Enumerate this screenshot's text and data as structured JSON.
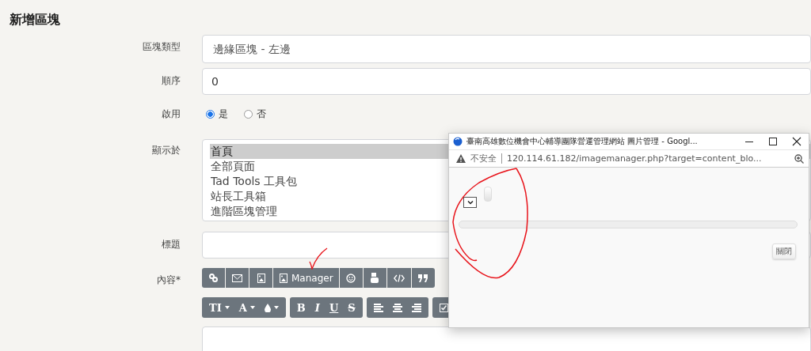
{
  "heading": "新增區塊",
  "form": {
    "block_type": {
      "label": "區塊類型",
      "value": "邊緣區塊 - 左邊"
    },
    "order": {
      "label": "順序",
      "value": "0"
    },
    "enabled": {
      "label": "啟用",
      "options": [
        {
          "label": "是",
          "selected": true
        },
        {
          "label": "否",
          "selected": false
        }
      ]
    },
    "show_on": {
      "label": "顯示於",
      "items": [
        {
          "label": "首頁",
          "selected": true
        },
        {
          "label": "全部頁面",
          "selected": false
        },
        {
          "label": "Tad Tools 工具包",
          "selected": false
        },
        {
          "label": "站長工具箱",
          "selected": false
        },
        {
          "label": "進階區塊管理",
          "selected": false
        }
      ]
    },
    "title": {
      "label": "標題"
    },
    "content": {
      "label": "內容*",
      "toolbar_1": [
        {
          "kind": "link"
        },
        {
          "kind": "mail"
        },
        {
          "kind": "image"
        },
        {
          "kind": "image",
          "text": "Manager"
        },
        {
          "kind": "smiley"
        },
        {
          "kind": "video"
        },
        {
          "kind": "code"
        },
        {
          "kind": "quote"
        }
      ],
      "toolbar_2": [
        [
          {
            "kind": "bold",
            "text": "TI",
            "menu": true
          },
          {
            "kind": "bold",
            "text": "A",
            "menu": true
          },
          {
            "kind": "drop",
            "menu": true
          }
        ],
        [
          {
            "kind": "bold",
            "text": "B"
          },
          {
            "kind": "italic",
            "text": "I"
          },
          {
            "kind": "underline",
            "text": "U"
          },
          {
            "kind": "strike",
            "text": "S"
          }
        ],
        [
          {
            "kind": "align-left"
          },
          {
            "kind": "align-center"
          },
          {
            "kind": "align-right"
          }
        ],
        [
          {
            "kind": "checkbox"
          }
        ]
      ]
    }
  },
  "popup": {
    "title": "臺南高雄數位機會中心輔導團隊營運管理網站 圖片管理 - Googl...",
    "security": "不安全",
    "url": "120.114.61.182/imagemanager.php?target=content_blo...",
    "close_button": "關閉"
  }
}
